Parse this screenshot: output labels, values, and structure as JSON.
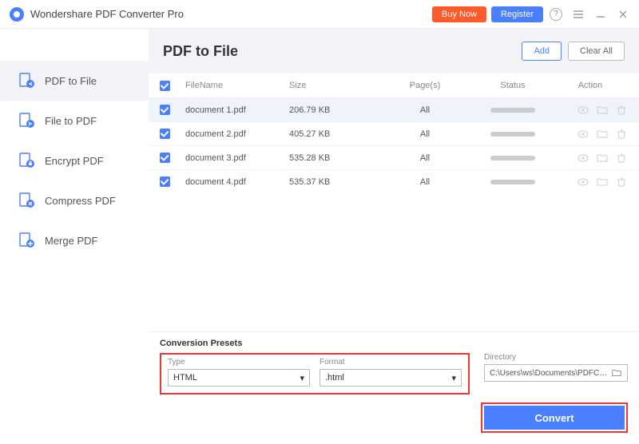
{
  "app": {
    "title": "Wondershare PDF Converter Pro"
  },
  "header_buttons": {
    "buy": "Buy Now",
    "register": "Register"
  },
  "sidebar": {
    "items": [
      {
        "label": "PDF to File"
      },
      {
        "label": "File to PDF"
      },
      {
        "label": "Encrypt PDF"
      },
      {
        "label": "Compress PDF"
      },
      {
        "label": "Merge PDF"
      }
    ]
  },
  "page": {
    "title": "PDF to File",
    "add": "Add",
    "clear": "Clear All"
  },
  "table": {
    "headers": {
      "name": "FileName",
      "size": "Size",
      "pages": "Page(s)",
      "status": "Status",
      "action": "Action"
    },
    "rows": [
      {
        "name": "document 1.pdf",
        "size": "206.79 KB",
        "pages": "All"
      },
      {
        "name": "document 2.pdf",
        "size": "405.27 KB",
        "pages": "All"
      },
      {
        "name": "document 3.pdf",
        "size": "535.28 KB",
        "pages": "All"
      },
      {
        "name": "document 4.pdf",
        "size": "535.37 KB",
        "pages": "All"
      }
    ]
  },
  "presets": {
    "title": "Conversion Presets",
    "type_label": "Type",
    "type_value": "HTML",
    "format_label": "Format",
    "format_value": ".html",
    "dir_label": "Directory",
    "dir_value": "C:\\Users\\ws\\Documents\\PDFConvert"
  },
  "convert": "Convert"
}
